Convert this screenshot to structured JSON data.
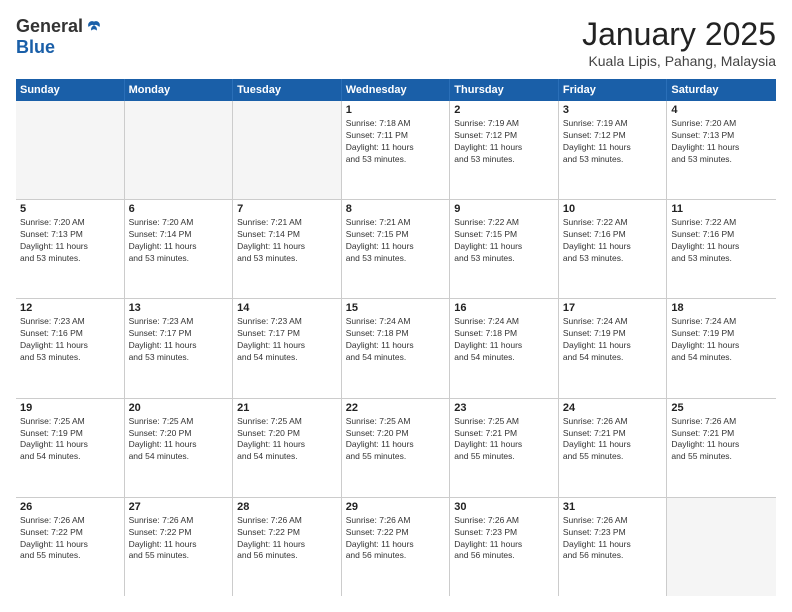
{
  "logo": {
    "general": "General",
    "blue": "Blue"
  },
  "title": "January 2025",
  "location": "Kuala Lipis, Pahang, Malaysia",
  "weekdays": [
    "Sunday",
    "Monday",
    "Tuesday",
    "Wednesday",
    "Thursday",
    "Friday",
    "Saturday"
  ],
  "weeks": [
    [
      {
        "day": "",
        "info": "",
        "empty": true
      },
      {
        "day": "",
        "info": "",
        "empty": true
      },
      {
        "day": "",
        "info": "",
        "empty": true
      },
      {
        "day": "1",
        "info": "Sunrise: 7:18 AM\nSunset: 7:11 PM\nDaylight: 11 hours\nand 53 minutes."
      },
      {
        "day": "2",
        "info": "Sunrise: 7:19 AM\nSunset: 7:12 PM\nDaylight: 11 hours\nand 53 minutes."
      },
      {
        "day": "3",
        "info": "Sunrise: 7:19 AM\nSunset: 7:12 PM\nDaylight: 11 hours\nand 53 minutes."
      },
      {
        "day": "4",
        "info": "Sunrise: 7:20 AM\nSunset: 7:13 PM\nDaylight: 11 hours\nand 53 minutes."
      }
    ],
    [
      {
        "day": "5",
        "info": "Sunrise: 7:20 AM\nSunset: 7:13 PM\nDaylight: 11 hours\nand 53 minutes."
      },
      {
        "day": "6",
        "info": "Sunrise: 7:20 AM\nSunset: 7:14 PM\nDaylight: 11 hours\nand 53 minutes."
      },
      {
        "day": "7",
        "info": "Sunrise: 7:21 AM\nSunset: 7:14 PM\nDaylight: 11 hours\nand 53 minutes."
      },
      {
        "day": "8",
        "info": "Sunrise: 7:21 AM\nSunset: 7:15 PM\nDaylight: 11 hours\nand 53 minutes."
      },
      {
        "day": "9",
        "info": "Sunrise: 7:22 AM\nSunset: 7:15 PM\nDaylight: 11 hours\nand 53 minutes."
      },
      {
        "day": "10",
        "info": "Sunrise: 7:22 AM\nSunset: 7:16 PM\nDaylight: 11 hours\nand 53 minutes."
      },
      {
        "day": "11",
        "info": "Sunrise: 7:22 AM\nSunset: 7:16 PM\nDaylight: 11 hours\nand 53 minutes."
      }
    ],
    [
      {
        "day": "12",
        "info": "Sunrise: 7:23 AM\nSunset: 7:16 PM\nDaylight: 11 hours\nand 53 minutes."
      },
      {
        "day": "13",
        "info": "Sunrise: 7:23 AM\nSunset: 7:17 PM\nDaylight: 11 hours\nand 53 minutes."
      },
      {
        "day": "14",
        "info": "Sunrise: 7:23 AM\nSunset: 7:17 PM\nDaylight: 11 hours\nand 54 minutes."
      },
      {
        "day": "15",
        "info": "Sunrise: 7:24 AM\nSunset: 7:18 PM\nDaylight: 11 hours\nand 54 minutes."
      },
      {
        "day": "16",
        "info": "Sunrise: 7:24 AM\nSunset: 7:18 PM\nDaylight: 11 hours\nand 54 minutes."
      },
      {
        "day": "17",
        "info": "Sunrise: 7:24 AM\nSunset: 7:19 PM\nDaylight: 11 hours\nand 54 minutes."
      },
      {
        "day": "18",
        "info": "Sunrise: 7:24 AM\nSunset: 7:19 PM\nDaylight: 11 hours\nand 54 minutes."
      }
    ],
    [
      {
        "day": "19",
        "info": "Sunrise: 7:25 AM\nSunset: 7:19 PM\nDaylight: 11 hours\nand 54 minutes."
      },
      {
        "day": "20",
        "info": "Sunrise: 7:25 AM\nSunset: 7:20 PM\nDaylight: 11 hours\nand 54 minutes."
      },
      {
        "day": "21",
        "info": "Sunrise: 7:25 AM\nSunset: 7:20 PM\nDaylight: 11 hours\nand 54 minutes."
      },
      {
        "day": "22",
        "info": "Sunrise: 7:25 AM\nSunset: 7:20 PM\nDaylight: 11 hours\nand 55 minutes."
      },
      {
        "day": "23",
        "info": "Sunrise: 7:25 AM\nSunset: 7:21 PM\nDaylight: 11 hours\nand 55 minutes."
      },
      {
        "day": "24",
        "info": "Sunrise: 7:26 AM\nSunset: 7:21 PM\nDaylight: 11 hours\nand 55 minutes."
      },
      {
        "day": "25",
        "info": "Sunrise: 7:26 AM\nSunset: 7:21 PM\nDaylight: 11 hours\nand 55 minutes."
      }
    ],
    [
      {
        "day": "26",
        "info": "Sunrise: 7:26 AM\nSunset: 7:22 PM\nDaylight: 11 hours\nand 55 minutes."
      },
      {
        "day": "27",
        "info": "Sunrise: 7:26 AM\nSunset: 7:22 PM\nDaylight: 11 hours\nand 55 minutes."
      },
      {
        "day": "28",
        "info": "Sunrise: 7:26 AM\nSunset: 7:22 PM\nDaylight: 11 hours\nand 56 minutes."
      },
      {
        "day": "29",
        "info": "Sunrise: 7:26 AM\nSunset: 7:22 PM\nDaylight: 11 hours\nand 56 minutes."
      },
      {
        "day": "30",
        "info": "Sunrise: 7:26 AM\nSunset: 7:23 PM\nDaylight: 11 hours\nand 56 minutes."
      },
      {
        "day": "31",
        "info": "Sunrise: 7:26 AM\nSunset: 7:23 PM\nDaylight: 11 hours\nand 56 minutes."
      },
      {
        "day": "",
        "info": "",
        "empty": true
      }
    ]
  ]
}
